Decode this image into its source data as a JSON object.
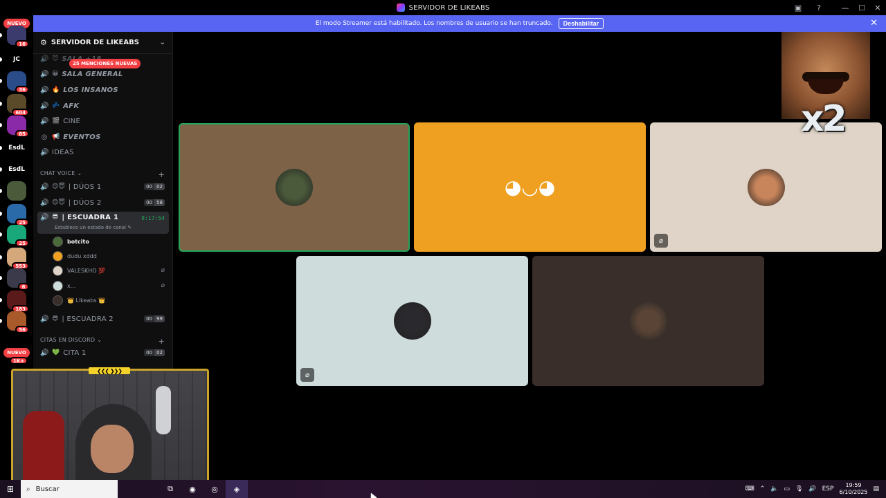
{
  "window": {
    "title": "SERVIDOR DE LIKEABS",
    "controls": [
      "▣",
      "?",
      "—",
      "☐",
      "✕"
    ]
  },
  "banner": {
    "message": "El modo Streamer está habilitado. Los nombres de usuario se han truncado.",
    "disable_label": "Deshabilitar",
    "close_label": "✕"
  },
  "rail": {
    "top_label": "NUEVO",
    "bottom_label": "NUEVO",
    "servers": [
      {
        "label": "",
        "badge": "16",
        "color": "#3b3b6e"
      },
      {
        "label": "JC",
        "badge": "",
        "color": "#000000"
      },
      {
        "label": "",
        "badge": "36",
        "color": "#2a4d8a"
      },
      {
        "label": "",
        "badge": "604",
        "color": "#5a4a2a"
      },
      {
        "label": "",
        "badge": "85",
        "color": "#8a2aa8"
      },
      {
        "label": "EsdL",
        "badge": "",
        "color": "#000000"
      },
      {
        "label": "EsdL",
        "badge": "",
        "color": "#000000"
      },
      {
        "label": "",
        "badge": "",
        "color": "#4a5a3a"
      },
      {
        "label": "",
        "badge": "25",
        "color": "#2a6aa8"
      },
      {
        "label": "",
        "badge": "25",
        "color": "#18a87a"
      },
      {
        "label": "",
        "badge": "553",
        "color": "#d4a87a"
      },
      {
        "label": "",
        "badge": "6",
        "color": "#3a3a4a"
      },
      {
        "label": "",
        "badge": "183",
        "color": "#5a1a1a"
      },
      {
        "label": "",
        "badge": "56",
        "color": "#a85a2a"
      }
    ],
    "bottom_badge": "1K+"
  },
  "sidebar": {
    "server_name": "SERVIDOR DE LIKEABS",
    "mentions_pill": "25 MENCIONES NUEVAS",
    "channels_top": [
      {
        "emoji": "😈",
        "name": "SALA +18",
        "italic": true
      },
      {
        "emoji": "😀",
        "name": "SALA GENERAL",
        "italic": true
      },
      {
        "emoji": "🔥",
        "name": "LOS INSANOS",
        "italic": true
      },
      {
        "emoji": "💤",
        "name": "AFK",
        "italic": true
      },
      {
        "emoji": "🎬",
        "name": "CINE",
        "italic": false
      },
      {
        "emoji": "📢",
        "name": "EVENTOS",
        "italic": true
      },
      {
        "emoji": "",
        "name": "IDEAS",
        "italic": false
      }
    ],
    "cat_chat_voice": "CHAT VOICE",
    "duos": [
      {
        "emoji": "😊😇",
        "name": "| DÚOS 1",
        "n1": "00",
        "n2": "02"
      },
      {
        "emoji": "😊😇",
        "name": "| DÚOS 2",
        "n1": "00",
        "n2": "58"
      }
    ],
    "escuadra1": {
      "emoji": "😎",
      "name": "| ESCUADRA 1",
      "timer": "8:17:54",
      "status_hint": "Establece un estado de canal ✎"
    },
    "members": [
      {
        "name": "botcito",
        "color": "#4a6a3a",
        "muted": false
      },
      {
        "name": "dudu xddd",
        "color": "#f0a020",
        "muted": false
      },
      {
        "name": "VALESKHO 💯",
        "color": "#e0d4c8",
        "muted": true
      },
      {
        "name": "x...",
        "color": "#cfdcdc",
        "muted": true
      },
      {
        "name": "👑 Likeabs 👑",
        "color": "#3a2e2a",
        "muted": false
      }
    ],
    "escuadra2": {
      "emoji": "😎",
      "name": "| ESCUADRA 2",
      "n1": "00",
      "n2": "99"
    },
    "cat_citas": "CITAS EN DISCORD",
    "cita1": {
      "emoji": "💚",
      "name": "CITA 1",
      "n1": "00",
      "n2": "02"
    }
  },
  "stage": {
    "tiles": [
      {
        "bg": "#7d6247",
        "speaking": true,
        "muted": false,
        "avatar": "#4a5a3a"
      },
      {
        "bg": "#f0a020",
        "speaking": false,
        "muted": false,
        "avatar": "discord"
      },
      {
        "bg": "#e0d4c8",
        "speaking": false,
        "muted": true,
        "avatar": "#c8845a"
      },
      {
        "bg": "#cfdcdc",
        "speaking": false,
        "muted": true,
        "avatar": "#2a2a2e"
      },
      {
        "bg": "#3a2e2a",
        "speaking": false,
        "muted": false,
        "avatar": "#5a4436"
      }
    ]
  },
  "overlay": {
    "multiplier": "x2",
    "webcam_chevrons": "❮❮❮ ❯❯❯"
  },
  "taskbar": {
    "search_label": "Buscar",
    "lang": "ESP",
    "time": "19:59",
    "date": "6/10/2025"
  }
}
